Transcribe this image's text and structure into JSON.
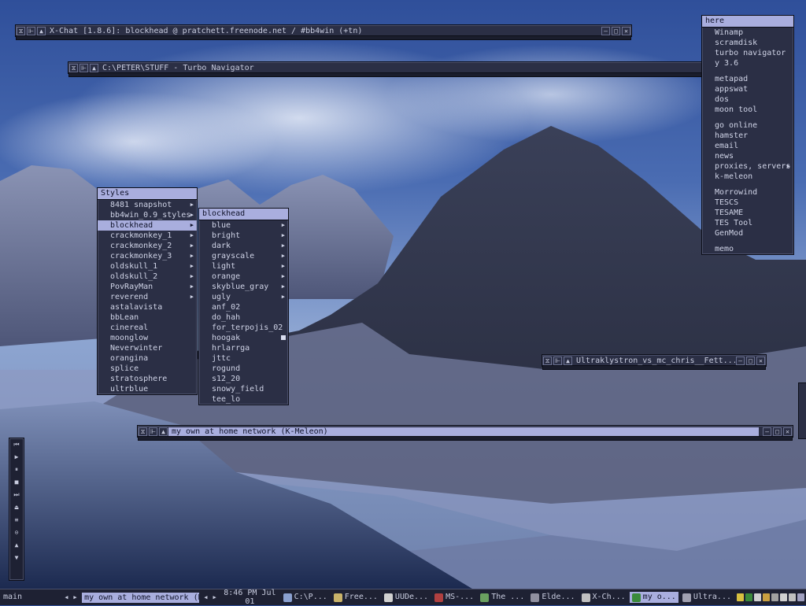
{
  "windows": {
    "xchat": {
      "title": "X-Chat [1.8.6]: blockhead @ pratchett.freenode.net / #bb4win (+tn)"
    },
    "turbo_navigator": {
      "title": "C:\\PETER\\STUFF - Turbo Navigator"
    },
    "ultraklystron": {
      "title": "Ultraklystron_vs_mc_chris__Fett..."
    },
    "kmeleon": {
      "title": "my own at home network (K-Meleon)"
    }
  },
  "styles_menu": {
    "title": "Styles",
    "items": [
      {
        "label": "8481 snapshot",
        "submenu": true
      },
      {
        "label": "bb4win_0.9_styles",
        "submenu": true
      },
      {
        "label": "blockhead",
        "submenu": true,
        "selected": true
      },
      {
        "label": "crackmonkey_1",
        "submenu": true
      },
      {
        "label": "crackmonkey_2",
        "submenu": true
      },
      {
        "label": "crackmonkey_3",
        "submenu": true
      },
      {
        "label": "oldskull_1",
        "submenu": true
      },
      {
        "label": "oldskull_2",
        "submenu": true
      },
      {
        "label": "PovRayMan",
        "submenu": true
      },
      {
        "label": "reverend",
        "submenu": true
      },
      {
        "label": "astalavista",
        "submenu": false
      },
      {
        "label": "bbLean",
        "submenu": false
      },
      {
        "label": "cinereal",
        "submenu": false
      },
      {
        "label": "moonglow",
        "submenu": false
      },
      {
        "label": "Neverwinter",
        "submenu": false
      },
      {
        "label": "orangina",
        "submenu": false
      },
      {
        "label": "splice",
        "submenu": false
      },
      {
        "label": "stratosphere",
        "submenu": false
      },
      {
        "label": "ultrblue",
        "submenu": false
      }
    ]
  },
  "blockhead_menu": {
    "title": "blockhead",
    "items": [
      {
        "label": "blue",
        "submenu": true
      },
      {
        "label": "bright",
        "submenu": true
      },
      {
        "label": "dark",
        "submenu": true
      },
      {
        "label": "grayscale",
        "submenu": true
      },
      {
        "label": "light",
        "submenu": true
      },
      {
        "label": "orange",
        "submenu": true
      },
      {
        "label": "skyblue_gray",
        "submenu": true
      },
      {
        "label": "ugly",
        "submenu": true
      },
      {
        "label": "anf_02",
        "submenu": false
      },
      {
        "label": "do_hah",
        "submenu": false
      },
      {
        "label": "for_terpojis_02",
        "submenu": false
      },
      {
        "label": "hoogak",
        "submenu": false,
        "checked": true
      },
      {
        "label": "hrlarrga",
        "submenu": false
      },
      {
        "label": "jttc",
        "submenu": false
      },
      {
        "label": "rogund",
        "submenu": false
      },
      {
        "label": "s12_20",
        "submenu": false
      },
      {
        "label": "snowy_field",
        "submenu": false
      },
      {
        "label": "tee_lo",
        "submenu": false
      }
    ]
  },
  "here_menu": {
    "title": "here",
    "groups": [
      [
        {
          "label": "Winamp"
        },
        {
          "label": "scramdisk"
        },
        {
          "label": "turbo navigator"
        },
        {
          "label": "y 3.6"
        }
      ],
      [
        {
          "label": "metapad"
        },
        {
          "label": "appswat"
        },
        {
          "label": "dos"
        },
        {
          "label": "moon tool"
        }
      ],
      [
        {
          "label": "go online"
        },
        {
          "label": "hamster"
        },
        {
          "label": "email"
        },
        {
          "label": "news"
        },
        {
          "label": "proxies, servers",
          "submenu": true
        },
        {
          "label": "k-meleon"
        }
      ],
      [
        {
          "label": "Morrowind"
        },
        {
          "label": "TESCS"
        },
        {
          "label": "TESAME"
        },
        {
          "label": "TES Tool"
        },
        {
          "label": "GenMod"
        }
      ],
      [
        {
          "label": "memo"
        }
      ]
    ]
  },
  "taskbar": {
    "workspace": "main",
    "focused": "my own at home network (K-...",
    "clock": "8:46 PM Jul 01",
    "tasks": [
      {
        "label": "C:\\P...",
        "color": "#8aa0d0"
      },
      {
        "label": "Free...",
        "color": "#c9b36a"
      },
      {
        "label": "UUDe...",
        "color": "#d0d0d0"
      },
      {
        "label": "MS-...",
        "color": "#b04040"
      },
      {
        "label": "The ...",
        "color": "#6aa060"
      },
      {
        "label": "Elde...",
        "color": "#9090a0"
      },
      {
        "label": "X-Ch...",
        "color": "#c0c0c0"
      },
      {
        "label": "my o...",
        "color": "#3a8a3a",
        "active": true
      },
      {
        "label": "Ultra...",
        "color": "#a0a0b0"
      }
    ],
    "tray_colors": [
      "#d8c040",
      "#3a8a3a",
      "#d0d0d0",
      "#c9a040",
      "#a0a0a0",
      "#d0d0d0",
      "#c0c0c0",
      "#a0a0c0"
    ]
  },
  "media_controls": [
    "prev-icon",
    "play-icon",
    "pause-icon",
    "stop-icon",
    "next-icon",
    "eject-icon",
    "playlist-icon",
    "options-icon",
    "volume-up-icon",
    "volume-down-icon"
  ]
}
